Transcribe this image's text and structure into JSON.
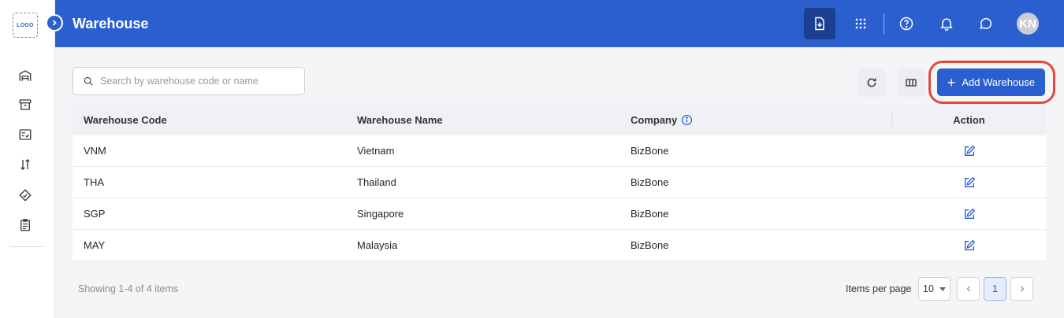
{
  "app": {
    "logo_text": "LOGO"
  },
  "header": {
    "title": "Warehouse",
    "avatar_initials": "KN"
  },
  "sidebar": {
    "items": [
      {
        "icon": "warehouse-icon"
      },
      {
        "icon": "archive-icon"
      },
      {
        "icon": "checklist-icon"
      },
      {
        "icon": "sort-icon"
      },
      {
        "icon": "tag-icon"
      },
      {
        "icon": "clipboard-icon"
      }
    ]
  },
  "toolbar": {
    "search_placeholder": "Search by warehouse code or name",
    "add_label": "Add Warehouse"
  },
  "table": {
    "columns": [
      "Warehouse Code",
      "Warehouse Name",
      "Company",
      "Action"
    ],
    "rows": [
      {
        "code": "VNM",
        "name": "Vietnam",
        "company": "BizBone"
      },
      {
        "code": "THA",
        "name": "Thailand",
        "company": "BizBone"
      },
      {
        "code": "SGP",
        "name": "Singapore",
        "company": "BizBone"
      },
      {
        "code": "MAY",
        "name": "Malaysia",
        "company": "BizBone"
      }
    ]
  },
  "footer": {
    "showing": "Showing 1-4 of 4 items",
    "items_per_page_label": "Items per page",
    "items_per_page_value": "10",
    "current_page": "1"
  },
  "colors": {
    "primary": "#2b5fd0",
    "highlight": "#e8463b"
  }
}
